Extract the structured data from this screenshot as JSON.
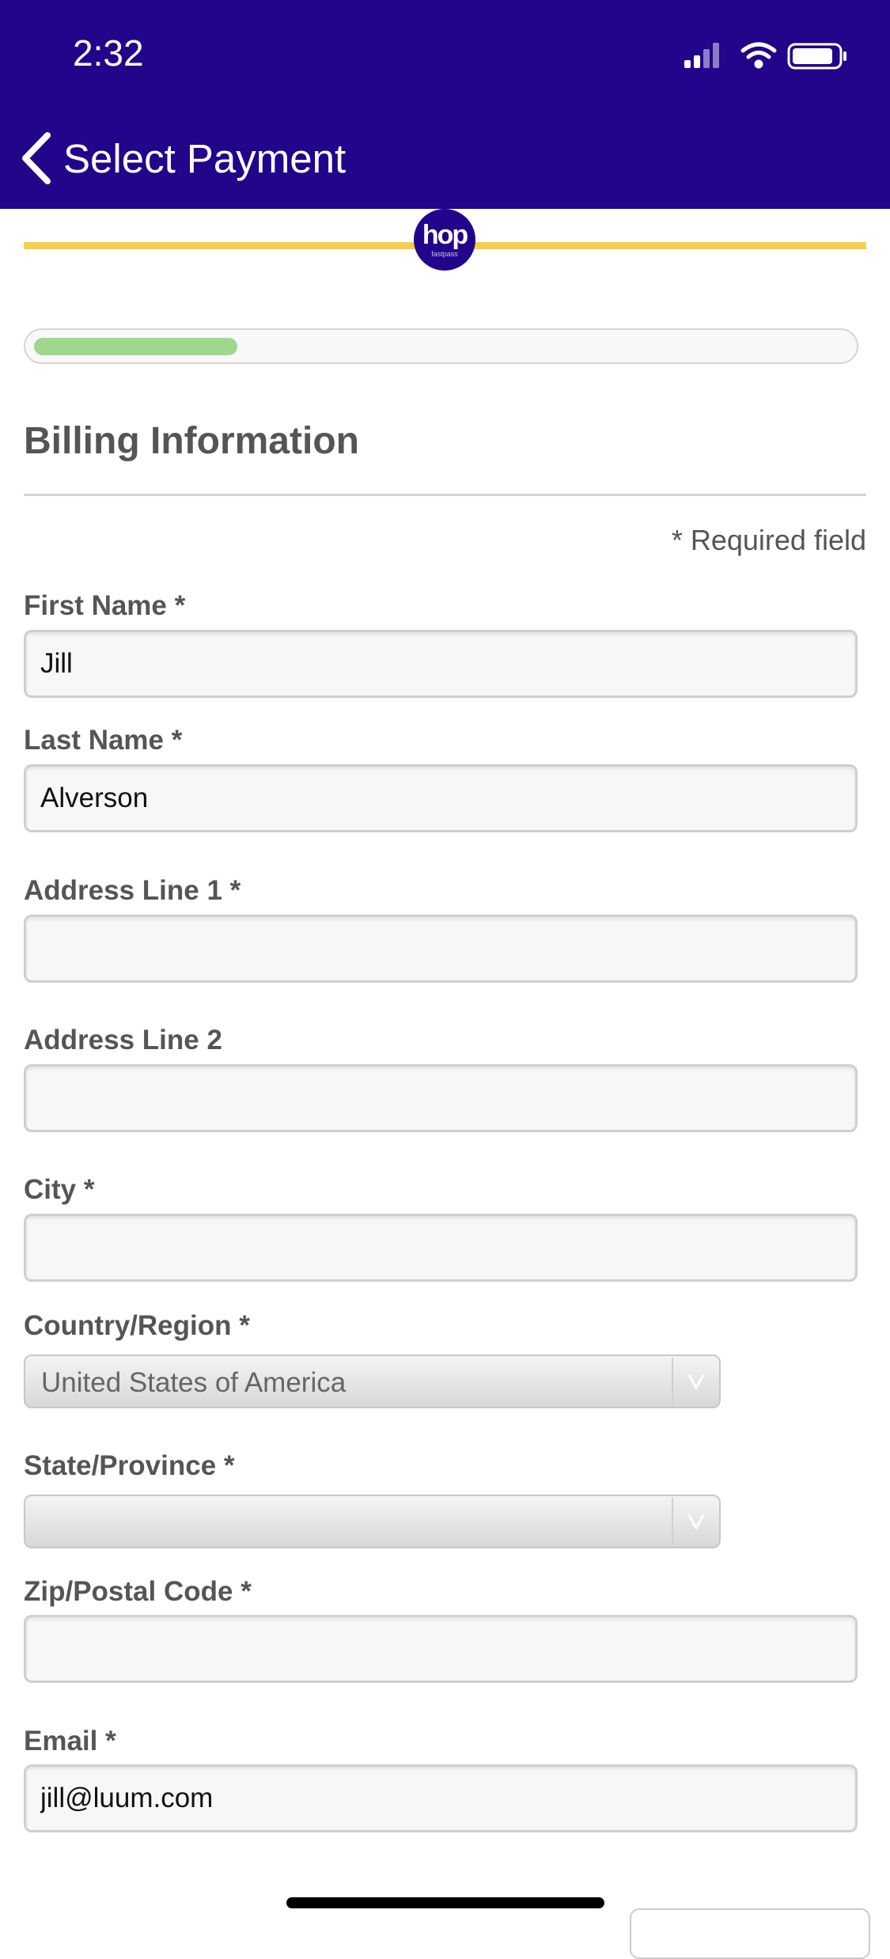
{
  "status_bar": {
    "time": "2:32"
  },
  "nav": {
    "back_label": "Select Payment"
  },
  "logo": {
    "text": "hop",
    "subtext": "fastpass"
  },
  "progress": {
    "fraction": 0.25
  },
  "form": {
    "title": "Billing Information",
    "required_note": "* Required field",
    "first_name": {
      "label": "First Name *",
      "value": "Jill"
    },
    "last_name": {
      "label": "Last Name *",
      "value": "Alverson"
    },
    "address1": {
      "label": "Address Line 1 *",
      "value": ""
    },
    "address2": {
      "label": "Address Line 2",
      "value": ""
    },
    "city": {
      "label": "City *",
      "value": ""
    },
    "country": {
      "label": "Country/Region *",
      "value": "United States of America"
    },
    "state": {
      "label": "State/Province *",
      "value": ""
    },
    "zip": {
      "label": "Zip/Postal Code *",
      "value": ""
    },
    "email": {
      "label": "Email *",
      "value": "jill@luum.com"
    }
  },
  "colors": {
    "header_bg": "#22058a",
    "accent_yellow": "#f6cf4e",
    "progress_green": "#9fd78d"
  }
}
